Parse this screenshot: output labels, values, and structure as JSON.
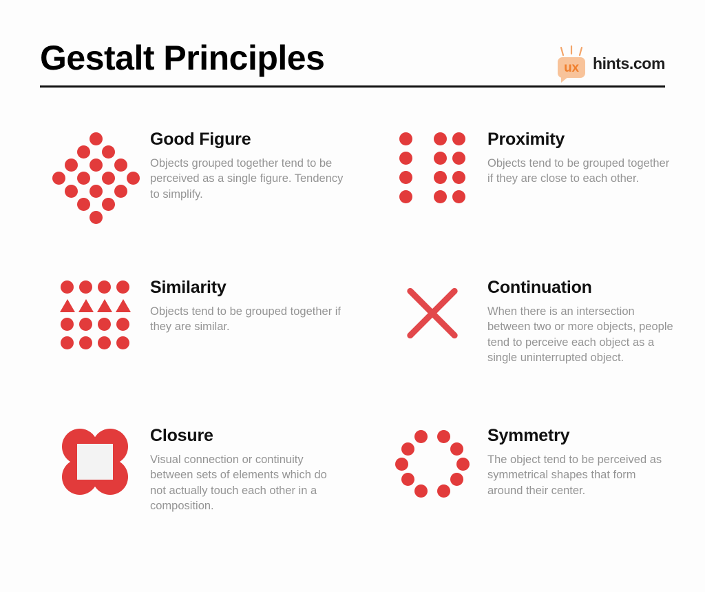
{
  "meta": {
    "background_color": "#fdfdfd",
    "accent_color": "#e23b3b",
    "title_color": "#000000",
    "body_text_color": "#949494",
    "logo_bubble_color": "#f8c39a",
    "logo_ux_color": "#f07f2d"
  },
  "header": {
    "title": "Gestalt Principles",
    "logo": {
      "mark_text": "ux",
      "word_text": "hints.com"
    }
  },
  "principles": [
    {
      "id": "good-figure",
      "title": "Good Figure",
      "description": "Objects grouped together tend to be perceived as a single figure. Tendency to simplify.",
      "visual": "diamond-dot-grid"
    },
    {
      "id": "proximity",
      "title": "Proximity",
      "description": "Objects tend to be grouped together if they are close to each other.",
      "visual": "three-column-dot-groups"
    },
    {
      "id": "similarity",
      "title": "Similarity",
      "description": "Objects tend to be grouped together if they are similar.",
      "visual": "dot-grid-with-triangle-row"
    },
    {
      "id": "continuation",
      "title": "Continuation",
      "description": "When there is an intersection between two or more objects, people tend to perceive each object as a single uninterrupted object.",
      "visual": "crossed-lines-x"
    },
    {
      "id": "closure",
      "title": "Closure",
      "description": "Visual connection or continuity between sets of elements which do not actually touch each other in a composition.",
      "visual": "four-circles-implied-square"
    },
    {
      "id": "symmetry",
      "title": "Symmetry",
      "description": "The object tend to be perceived as symmetrical shapes that form around their center.",
      "visual": "mirrored-dot-arcs"
    }
  ]
}
